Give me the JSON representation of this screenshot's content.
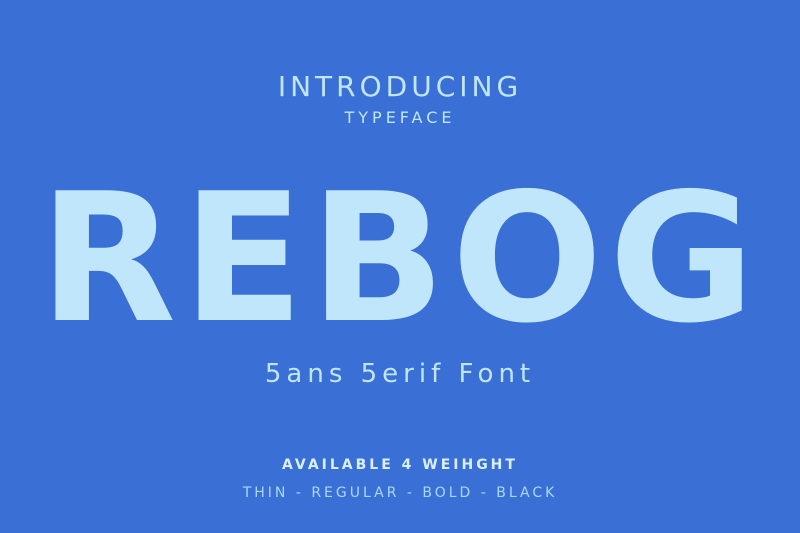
{
  "poster": {
    "intro": "INTRODUCING",
    "kind": "TYPEFACE",
    "brand": "REBOG",
    "subtitle": "5ans 5erif Font",
    "available": "AVAILABLE 4 WEIHGHT",
    "weights": "THIN - REGULAR - BOLD - BLACK"
  },
  "colors": {
    "background": "#3a6fd6",
    "text": "#bfe6fb"
  }
}
